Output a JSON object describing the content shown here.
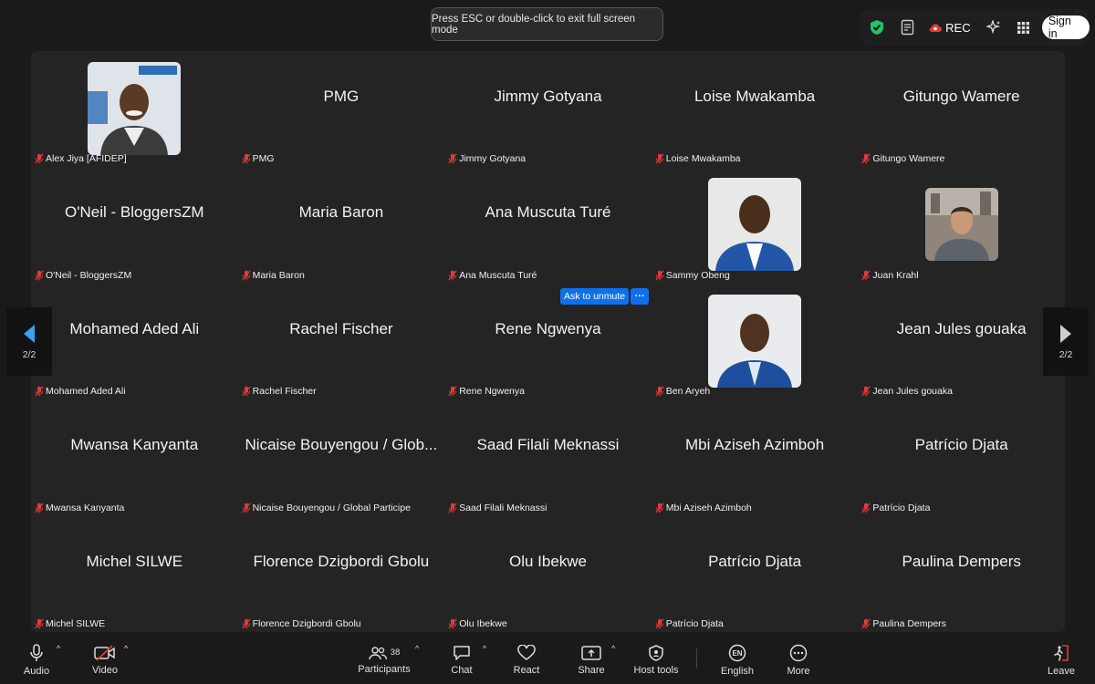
{
  "banner": {
    "text": "Press ESC or double-click to exit full screen mode"
  },
  "topbar": {
    "icons": [
      "shield-check-icon",
      "notes-icon",
      "cloud-rec-icon",
      "ai-sparkle-icon",
      "apps-grid-icon"
    ],
    "rec_label": "REC",
    "signin_label": "Sign in",
    "accent": "#21c36b"
  },
  "participants": [
    {
      "display": "",
      "label": "Alex Jiya [AFIDEP]",
      "photo": "afidep"
    },
    {
      "display": "PMG",
      "label": "PMG"
    },
    {
      "display": "Jimmy Gotyana",
      "label": "Jimmy Gotyana"
    },
    {
      "display": "Loise Mwakamba",
      "label": "Loise Mwakamba"
    },
    {
      "display": "Gitungo Wamere",
      "label": "Gitungo Wamere"
    },
    {
      "display": "O'Neil - BloggersZM",
      "label": "O'Neil - BloggersZM"
    },
    {
      "display": "Maria Baron",
      "label": "Maria Baron"
    },
    {
      "display": "Ana Muscuta Turé",
      "label": "Ana Muscuta Turé"
    },
    {
      "display": "",
      "label": "Sammy Obeng",
      "photo": "bluesuit"
    },
    {
      "display": "",
      "label": "Juan Krahl",
      "photo": "outdoor"
    },
    {
      "display": "Mohamed Aded Ali",
      "label": "Mohamed Aded Ali"
    },
    {
      "display": "Rachel Fischer",
      "label": "Rachel Fischer"
    },
    {
      "display": "Rene Ngwenya",
      "label": "Rene Ngwenya"
    },
    {
      "display": "",
      "label": "Ben Aryeh",
      "photo": "bluesuit2"
    },
    {
      "display": "Jean Jules gouaka",
      "label": "Jean Jules gouaka"
    },
    {
      "display": "Mwansa Kanyanta",
      "label": "Mwansa Kanyanta"
    },
    {
      "display": "Nicaise Bouyengou / Glob...",
      "label": "Nicaise Bouyengou / Global Participe"
    },
    {
      "display": "Saad Filali Meknassi",
      "label": "Saad Filali Meknassi"
    },
    {
      "display": "Mbi Aziseh Azimboh",
      "label": "Mbi Aziseh Azimboh"
    },
    {
      "display": "Patrício Djata",
      "label": "Patrício Djata"
    },
    {
      "display": "Michel SILWE",
      "label": "Michel SILWE"
    },
    {
      "display": "Florence Dzigbordi Gbolu",
      "label": "Florence Dzigbordi Gbolu"
    },
    {
      "display": "Olu Ibekwe",
      "label": "Olu Ibekwe"
    },
    {
      "display": "Patrício Djata",
      "label": "Patrício Djata"
    },
    {
      "display": "Paulina Dempers",
      "label": "Paulina Dempers"
    }
  ],
  "ask_unmute": {
    "label": "Ask to unmute",
    "more": "···"
  },
  "pager": {
    "left": "2/2",
    "right": "2/2"
  },
  "toolbar": {
    "audio": "Audio",
    "video": "Video",
    "participants": "Participants",
    "participant_count": "38",
    "chat": "Chat",
    "react": "React",
    "share": "Share",
    "host_tools": "Host tools",
    "english": "English",
    "more": "More",
    "leave": "Leave",
    "muted_color": "#e5383b"
  }
}
